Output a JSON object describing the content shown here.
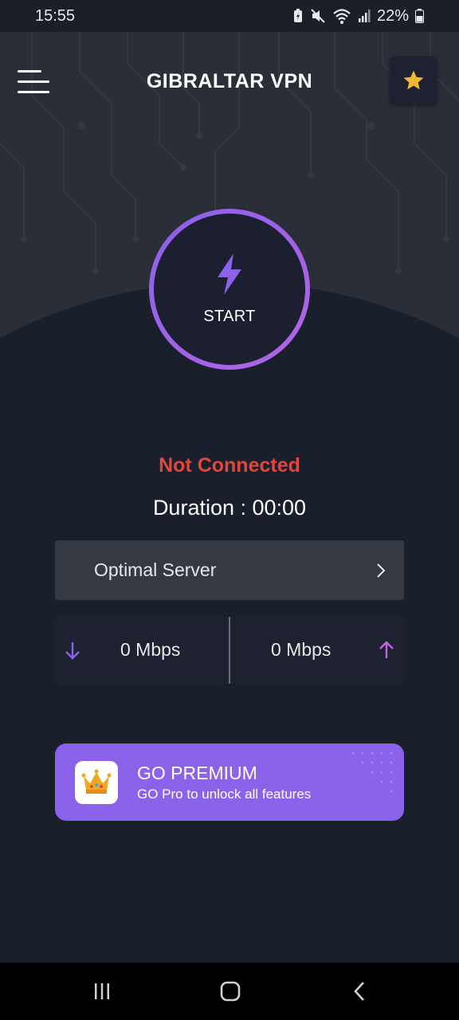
{
  "status_bar": {
    "time": "15:55",
    "battery": "22%",
    "icons": [
      "battery-saver-icon",
      "mute-icon",
      "wifi-icon",
      "signal-icon",
      "battery-icon"
    ]
  },
  "header": {
    "title": "GIBRALTAR VPN",
    "menu_icon": "menu-icon",
    "favorite_icon": "star-icon"
  },
  "connect": {
    "label": "START",
    "icon": "lightning-icon"
  },
  "status": {
    "connection": "Not Connected",
    "duration": "Duration : 00:00"
  },
  "server": {
    "label": "Optimal Server",
    "icon": "chevron-right-icon"
  },
  "speed": {
    "download": "0 Mbps",
    "upload": "0 Mbps",
    "download_icon": "arrow-down-icon",
    "upload_icon": "arrow-up-icon"
  },
  "premium": {
    "title": "GO PREMIUM",
    "subtitle": "GO Pro to unlock all features",
    "icon": "crown-icon"
  },
  "colors": {
    "background": "#1a1f2c",
    "accent": "#8b62ea",
    "error": "#e3463d",
    "star": "#f5b731"
  }
}
